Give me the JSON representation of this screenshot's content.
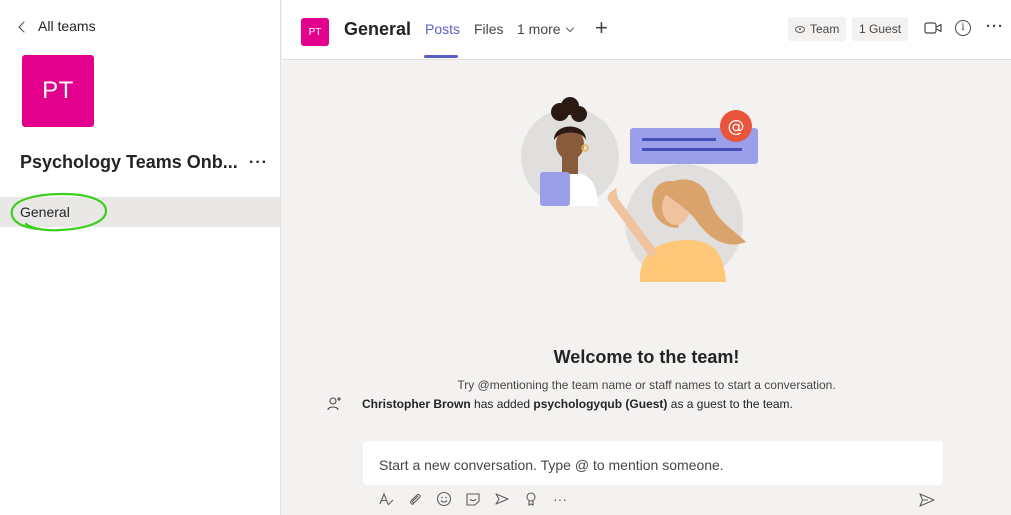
{
  "sidebar": {
    "back_label": "All teams",
    "team_initials": "PT",
    "team_name": "Psychology Teams Onb...",
    "more_label": "···",
    "channels": [
      {
        "label": "General"
      }
    ]
  },
  "header": {
    "team_initials": "PT",
    "channel_title": "General",
    "tabs": [
      {
        "label": "Posts"
      },
      {
        "label": "Files"
      },
      {
        "label": "1 more"
      }
    ],
    "add_tab": "+",
    "team_pill": "Team",
    "guest_pill": "1 Guest",
    "info_glyph": "i",
    "more_label": "···"
  },
  "main": {
    "welcome_title": "Welcome to the team!",
    "welcome_subtitle": "Try @mentioning the team name or staff names to start a conversation.",
    "activity": {
      "actor": "Christopher Brown",
      "text_mid": "has added",
      "guest": "psychologyqub (Guest)",
      "text_end": "as a guest to the team."
    },
    "compose_placeholder": "Start a new conversation. Type @ to mention someone.",
    "toolbar_more": "···"
  },
  "colors": {
    "brand_avatar": "#e3008c",
    "accent": "#5b5fc7",
    "annotation": "#3ccf1e"
  }
}
